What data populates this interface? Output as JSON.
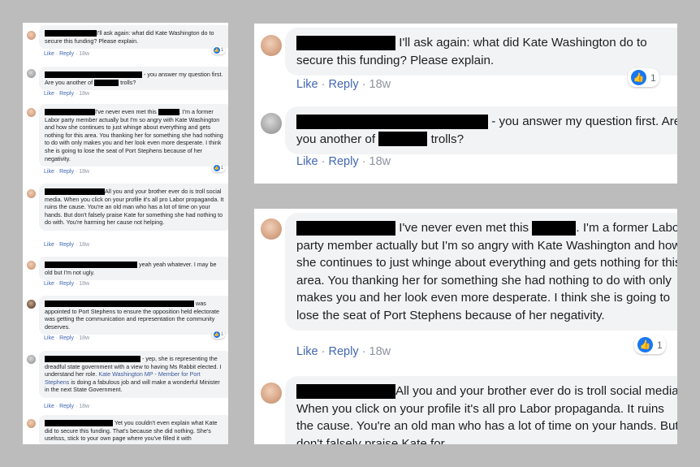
{
  "labels": {
    "like": "Like",
    "reply": "Reply",
    "separator": "·"
  },
  "reaction_icon": "thumbs-up-icon",
  "left_comments": [
    {
      "text": "I'll ask again: what did Kate Washington do to secure this funding? Please explain.",
      "age": "18w",
      "reactions": "1"
    },
    {
      "text_a": "- you answer my question first. Are you another of",
      "text_b": "trolls?",
      "age": "18w"
    },
    {
      "text_a": "I've never even met this",
      "text_b": ". I'm a former Labor party member actually but I'm so angry with Kate Washington and how she continues to just whinge about everything and gets nothing for this area. You thanking her for something she had nothing to do with only makes you and her look even more desperate. I think she is going to lose the seat of Port Stephens because of her negativity.",
      "age": "18w",
      "reactions": "1"
    },
    {
      "text": "All you and your brother ever do is troll social media. When you click on your profile it's all pro Labor propaganda. It ruins the cause. You're an old man who has a lot of time on your hands. But don't falsely praise Kate for something she had nothing to do with. You're harming her cause not helping.",
      "age": "18w"
    },
    {
      "text": "yeah yeah whatever. I may be old but I'm not ugly.",
      "age": "18w"
    },
    {
      "text": "was appointed to Port Stephens to ensure the opposition held electorate was getting the communication and representation the community deserves.",
      "age": "18w",
      "reactions": "1"
    },
    {
      "text_a": "- yep, she is representing the dreadful state government with a view to having Ms Rabbit elected. I understand her role.",
      "link": "Kate Washington MP - Member for Port Stephens",
      "text_b": "is doing a fabulous job and will make a wonderful Minister in the next State Government.",
      "age": "18w"
    },
    {
      "text": "Yet you couldn't even explain what Kate did to secure this funding. That's because she did nothing. She's uselsss, stick to your own page where you've filled it with"
    }
  ],
  "right_top_comments": [
    {
      "text": "I'll ask again: what did Kate Washington do to secure this funding? Please explain.",
      "age": "18w",
      "reactions": "1"
    },
    {
      "text_a": "- you answer my question first. Are you another of",
      "text_b": "trolls?",
      "age": "18w"
    }
  ],
  "right_bottom_comments": [
    {
      "text_a": "I've never even met this",
      "text_b": ". I'm a former Labor party member actually but I'm so angry with Kate Washington and how she continues to just whinge about everything and gets nothing for this area. You thanking her for something she had nothing to do with only makes you and her look even more desperate. I think she is going to lose the seat of Port Stephens because of her negativity.",
      "age": "18w",
      "reactions": "1"
    },
    {
      "text": "All you and your brother ever do is troll social media. When you click on your profile it's all pro Labor propaganda. It ruins the cause. You're an old man who has a lot of time on your hands. But don't falsely praise Kate for"
    }
  ]
}
